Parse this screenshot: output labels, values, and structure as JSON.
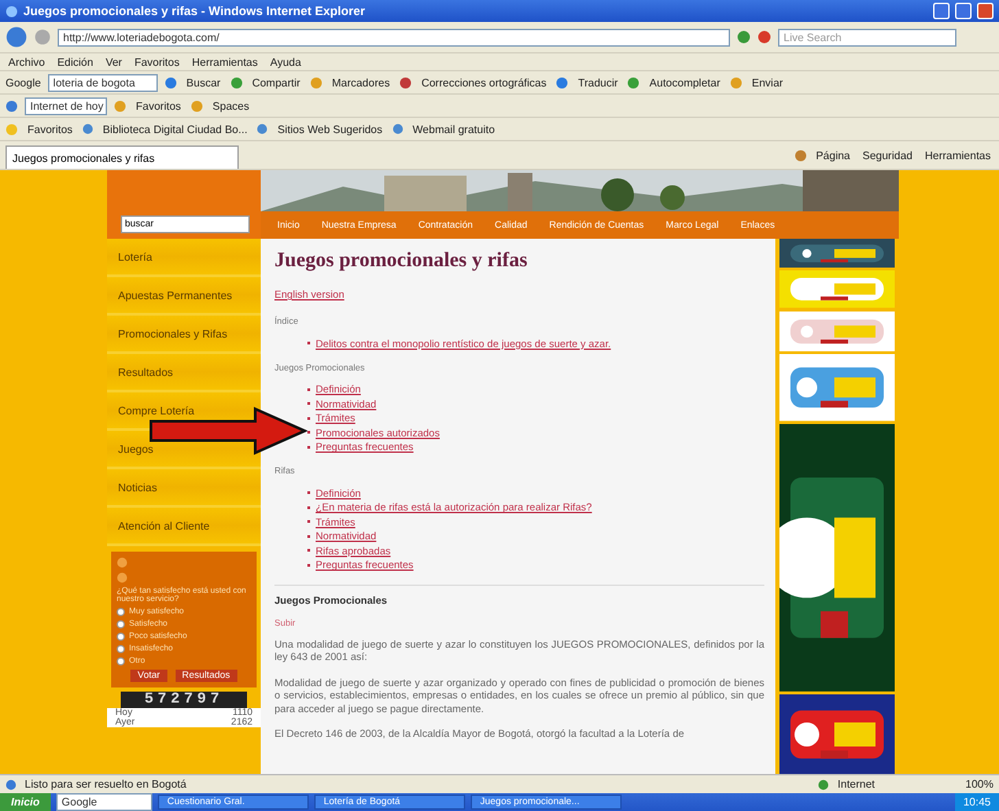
{
  "window": {
    "title": "Juegos promocionales y rifas - Windows Internet Explorer"
  },
  "address_bar": {
    "url": "http://www.loteriadebogota.com/",
    "search_placeholder": "Live Search"
  },
  "menu_bar": [
    "Archivo",
    "Edición",
    "Ver",
    "Favoritos",
    "Herramientas",
    "Ayuda"
  ],
  "google_toolbar": {
    "label": "Google",
    "search_value": "loteria de bogota",
    "buttons": [
      "Buscar",
      "Compartir",
      "Marcadores",
      "Correcciones ortográficas",
      "Traducir",
      "Autocompletar",
      "Enviar"
    ]
  },
  "links_toolbar": {
    "search_value": "Internet de hoy",
    "buttons": [
      "Favoritos",
      "Spaces"
    ]
  },
  "favorites_bar": {
    "label": "Favoritos",
    "links": [
      "Biblioteca Digital Ciudad Bo...",
      "Sitios Web Sugeridos",
      "Webmail gratuito"
    ]
  },
  "tabs": [
    {
      "label": "Juegos promocionales y rifas",
      "selected": true
    }
  ],
  "command_bar": [
    "Página",
    "Seguridad",
    "Herramientas"
  ],
  "site": {
    "search": {
      "value": "buscar"
    },
    "nav": [
      "Inicio",
      "Nuestra Empresa",
      "Contratación",
      "Calidad",
      "Rendición de Cuentas",
      "Marco Legal",
      "Enlaces"
    ],
    "side_menu": [
      "Lotería",
      "Apuestas Permanentes",
      "Promocionales y Rifas",
      "Resultados",
      "Compre Lotería",
      "Juegos",
      "Noticias",
      "Atención al Cliente"
    ],
    "poll": {
      "question": "¿Qué tan satisfecho está usted con nuestro servicio?",
      "options": [
        {
          "label": "Muy satisfecho",
          "selected": false
        },
        {
          "label": "Satisfecho",
          "selected": false
        },
        {
          "label": "Poco satisfecho",
          "selected": false
        },
        {
          "label": "Insatisfecho",
          "selected": false
        },
        {
          "label": "Otro",
          "selected": false
        }
      ],
      "buttons": [
        "Votar",
        "Resultados"
      ]
    },
    "counter": "572797",
    "stats": [
      {
        "label": "Hoy",
        "value": "1110"
      },
      {
        "label": "Ayer",
        "value": "2162"
      }
    ],
    "article": {
      "title": "Juegos promocionales y rifas",
      "english_link": "English version",
      "sections": [
        {
          "heading": "Índice",
          "links": [
            "Delitos contra el monopolio rentístico de juegos de suerte y azar."
          ]
        },
        {
          "heading": "Juegos Promocionales",
          "links": [
            "Definición",
            "Normatividad",
            "Trámites",
            "Promocionales autorizados",
            "Preguntas frecuentes"
          ]
        },
        {
          "heading": "Rifas",
          "links": [
            "Definición",
            "¿En materia de rifas está la autorización para realizar Rifas?",
            "Trámites",
            "Normatividad",
            "Rifas aprobadas",
            "Preguntas frecuentes"
          ]
        }
      ],
      "content_heading": "Juegos Promocionales",
      "top_link": "Subir",
      "paragraphs": [
        "Una modalidad de juego de suerte y azar lo constituyen los JUEGOS PROMOCIONALES, definidos por la ley 643 de 2001 así:",
        "Modalidad de juego de suerte y azar organizado y operado con fines de publicidad o promoción de bienes o servicios, establecimientos, empresas o entidades, en los cuales se ofrece un premio al público, sin que para acceder al juego se pague directamente.",
        "El Decreto 146 de 2003, de la Alcaldía Mayor de Bogotá, otorgó la facultad a la Lotería de"
      ]
    }
  },
  "status_bar": {
    "text": "Listo para ser resuelto en Bogotá",
    "zone": "Internet",
    "zoom": "100%"
  },
  "taskbar": {
    "start": "Inicio",
    "search": "Google",
    "items": [
      "Cuestionario Gral.",
      "Lotería de Bogotá",
      "Juegos promocionale..."
    ],
    "time": "10:45"
  }
}
